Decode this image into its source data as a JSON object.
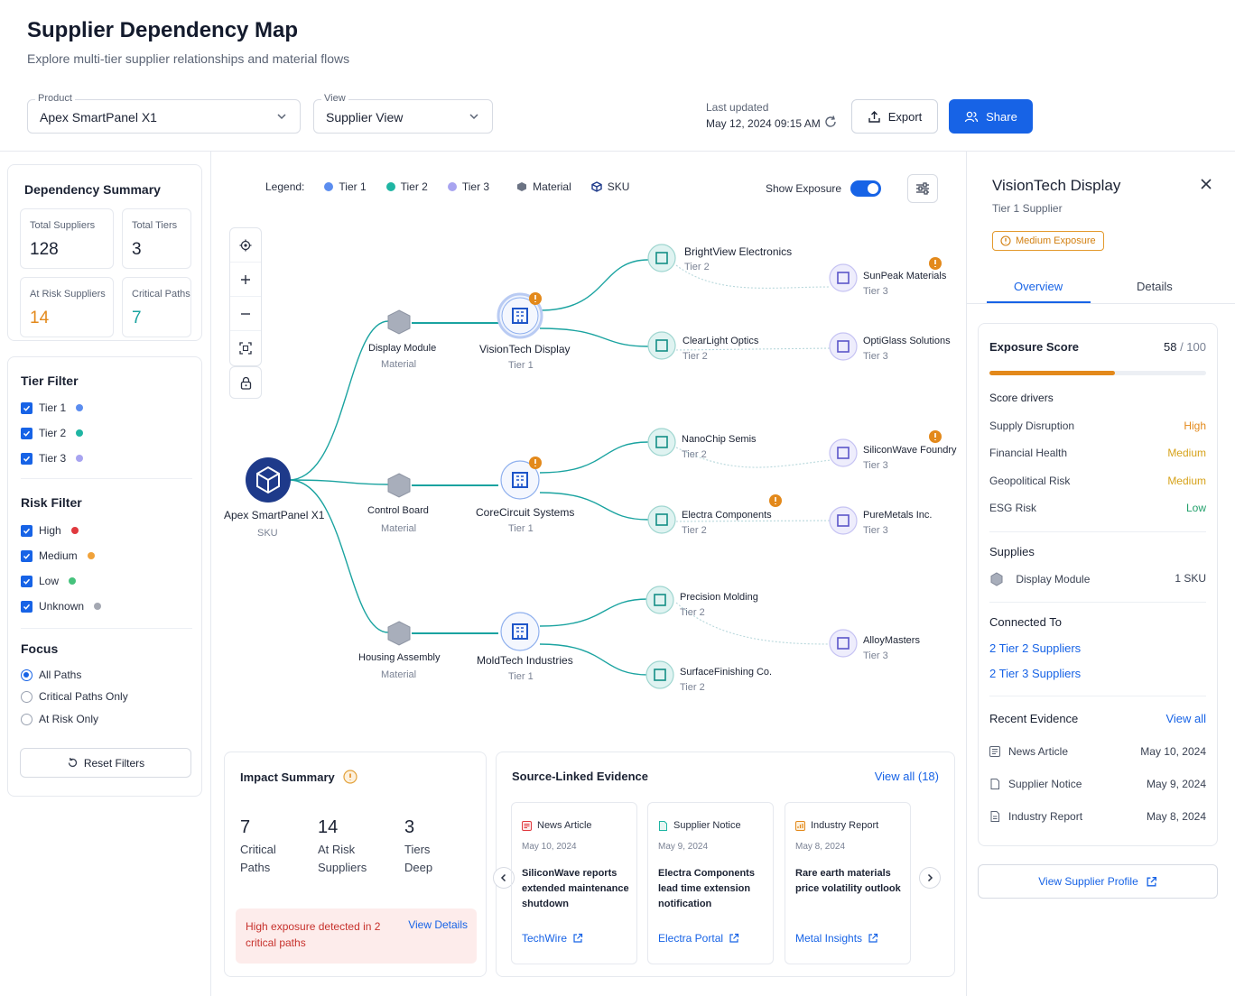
{
  "header": {
    "title": "Supplier Dependency Map",
    "subtitle": "Explore multi-tier supplier relationships and material flows",
    "product_label": "Product",
    "product_value": "Apex SmartPanel X1",
    "view_label": "View",
    "view_value": "Supplier View",
    "last_updated_label": "Last updated",
    "last_updated_value": "May 12, 2024 09:15 AM",
    "export_label": "Export",
    "share_label": "Share",
    "accent_color": "#1763e6"
  },
  "summary": {
    "title": "Dependency Summary",
    "stats": [
      {
        "label": "Total Suppliers",
        "value": "128"
      },
      {
        "label": "Total Tiers",
        "value": "3"
      },
      {
        "label": "At Risk Suppliers",
        "value": "14"
      },
      {
        "label": "Critical Paths",
        "value": "7"
      }
    ]
  },
  "filters": {
    "tier_title": "Tier Filter",
    "tiers": [
      "Tier 1",
      "Tier 2",
      "Tier 3"
    ],
    "risk_title": "Risk Filter",
    "risks": [
      "High",
      "Medium",
      "Low",
      "Unknown"
    ],
    "focus_title": "Focus",
    "focus_options": [
      "All Paths",
      "Critical Paths Only",
      "At Risk Only"
    ],
    "focus_selected": "All Paths",
    "reset_label": "Reset Filters"
  },
  "legend": {
    "title": "Legend:",
    "items": [
      "Tier 1",
      "Tier 2",
      "Tier 3",
      "Material",
      "SKU"
    ],
    "show_exposure_label": "Show Exposure",
    "show_exposure_on": true
  },
  "graph": {
    "sku": {
      "name": "Apex SmartPanel X1",
      "sub": "SKU"
    },
    "materials": [
      {
        "name": "Display Module",
        "sub": "Material"
      },
      {
        "name": "Control Board",
        "sub": "Material"
      },
      {
        "name": "Housing Assembly",
        "sub": "Material"
      }
    ],
    "tier1": [
      {
        "name": "VisionTech Display",
        "sub": "Tier 1",
        "alert": true
      },
      {
        "name": "CoreCircuit Systems",
        "sub": "Tier 1",
        "alert": true
      },
      {
        "name": "MoldTech Industries",
        "sub": "Tier 1",
        "alert": false
      }
    ],
    "tier2": [
      {
        "name": "BrightView Electronics",
        "sub": "Tier 2"
      },
      {
        "name": "ClearLight Optics",
        "sub": "Tier 2"
      },
      {
        "name": "NanoChip Semis",
        "sub": "Tier 2"
      },
      {
        "name": "Electra Components",
        "sub": "Tier 2"
      },
      {
        "name": "Precision Molding",
        "sub": "Tier 2"
      },
      {
        "name": "SurfaceFinishing Co.",
        "sub": "Tier 2"
      }
    ],
    "tier3": [
      {
        "name": "SunPeak Materials",
        "sub": "Tier 3"
      },
      {
        "name": "OptiGlass Solutions",
        "sub": "Tier 3"
      },
      {
        "name": "SiliconWave Foundry",
        "sub": "Tier 3"
      },
      {
        "name": "PureMetals Inc.",
        "sub": "Tier 3"
      },
      {
        "name": "AlloyMasters",
        "sub": "Tier 3"
      }
    ]
  },
  "impact": {
    "title": "Impact Summary",
    "stats": [
      {
        "value": "7",
        "label_1": "Critical",
        "label_2": "Paths"
      },
      {
        "value": "14",
        "label_1": "At Risk",
        "label_2": "Suppliers"
      },
      {
        "value": "3",
        "label_1": "Tiers",
        "label_2": "Deep"
      }
    ],
    "alert_bold_1": "High",
    "alert_mid": " exposure detected in ",
    "alert_bold_2": "2",
    "alert_end": " critical paths",
    "alert_link": "View Details"
  },
  "evidence": {
    "title": "Source-Linked Evidence",
    "view_all": "View all (18)",
    "items": [
      {
        "type": "News Article",
        "date": "May 10, 2024",
        "headline": "SiliconWave reports extended maintenance shutdown",
        "source": "TechWire"
      },
      {
        "type": "Supplier Notice",
        "date": "May 9, 2024",
        "headline": "Electra Components lead time extension notification",
        "source": "Electra Portal"
      },
      {
        "type": "Industry Report",
        "date": "May 8, 2024",
        "headline": "Rare earth materials price volatility outlook",
        "source": "Metal Insights"
      }
    ]
  },
  "detail": {
    "title": "VisionTech Display",
    "subtitle": "Tier 1 Supplier",
    "badge": "Medium Exposure",
    "tabs": [
      "Overview",
      "Details"
    ],
    "exposure_title": "Exposure Score",
    "score": "58",
    "score_max": "/ 100",
    "score_fraction": 0.58,
    "drivers_title": "Score drivers",
    "drivers": [
      {
        "label": "Supply Disruption",
        "value": "High",
        "color": "#e3891b"
      },
      {
        "label": "Financial Health",
        "value": "Medium",
        "color": "#d6a21a"
      },
      {
        "label": "Geopolitical Risk",
        "value": "Medium",
        "color": "#d6a21a"
      },
      {
        "label": "ESG Risk",
        "value": "Low",
        "color": "#22a06b"
      }
    ],
    "supplies_title": "Supplies",
    "supplies_item": "Display Module",
    "supplies_count": "1 SKU",
    "connected_title": "Connected To",
    "connected": [
      "2 Tier 2 Suppliers",
      "2 Tier 3 Suppliers"
    ],
    "recent_title": "Recent Evidence",
    "recent_view_all": "View all",
    "recent": [
      {
        "label": "News Article",
        "date": "May 10, 2024"
      },
      {
        "label": "Supplier Notice",
        "date": "May 9, 2024"
      },
      {
        "label": "Industry Report",
        "date": "May 8, 2024"
      }
    ],
    "profile_button": "View Supplier Profile"
  },
  "colors": {
    "tier1": "#5b8def",
    "tier2": "#1fb5a3",
    "tier3": "#a8a4f0",
    "high": "#e0393e",
    "medium": "#f0a23a",
    "low": "#45c27c",
    "unknown": "#a4a8b2",
    "teal_link": "#1aa3a0"
  }
}
